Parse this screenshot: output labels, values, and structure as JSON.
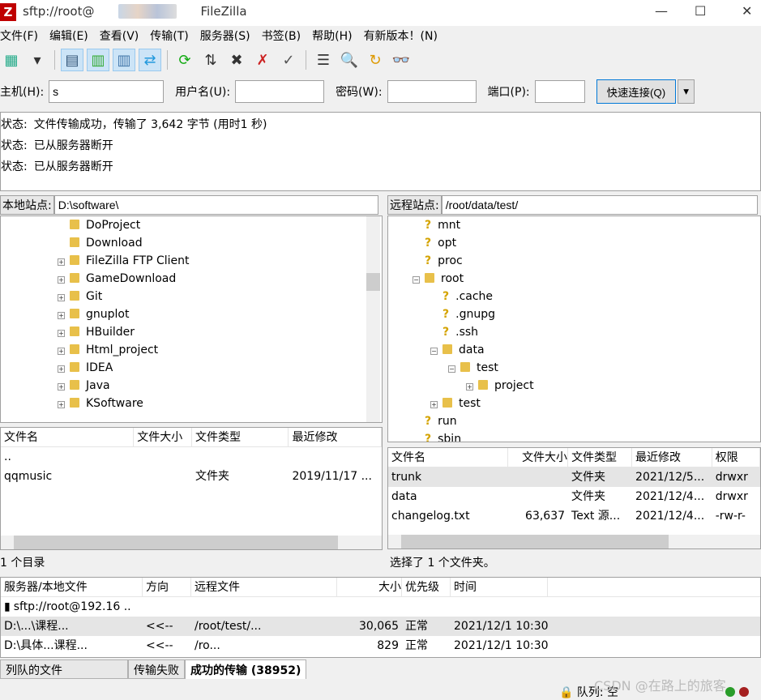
{
  "window": {
    "title": "sftp://root@",
    "title_app": "FileZilla",
    "min": "—",
    "max": "☐",
    "close": "✕"
  },
  "menu": [
    "文件(F)",
    "编辑(E)",
    "查看(V)",
    "传输(T)",
    "服务器(S)",
    "书签(B)",
    "帮助(H)",
    "有新版本！(N)"
  ],
  "toolbar": [
    {
      "name": "site-manager-icon",
      "glyph": "▦"
    },
    {
      "name": "dropdown-arrow-icon",
      "glyph": "▾"
    },
    {
      "name": "toggle-log-icon",
      "glyph": "▤",
      "on": true
    },
    {
      "name": "toggle-local-tree-icon",
      "glyph": "▥",
      "on": true
    },
    {
      "name": "toggle-remote-tree-icon",
      "glyph": "▥",
      "on": true
    },
    {
      "name": "toggle-queue-icon",
      "glyph": "⇄",
      "on": true
    },
    {
      "name": "refresh-icon",
      "glyph": "⟳"
    },
    {
      "name": "process-queue-icon",
      "glyph": "⇅"
    },
    {
      "name": "cancel-icon",
      "glyph": "✖"
    },
    {
      "name": "disconnect-icon",
      "glyph": "✗"
    },
    {
      "name": "reconnect-icon",
      "glyph": "✓"
    },
    {
      "name": "directory-compare-icon",
      "glyph": "☰"
    },
    {
      "name": "search-icon",
      "glyph": "🔍"
    },
    {
      "name": "sync-browse-icon",
      "glyph": "↻"
    },
    {
      "name": "find-files-icon",
      "glyph": "👓"
    }
  ],
  "quickconnect": {
    "host_label": "主机(H):",
    "host_value": "s",
    "user_label": "用户名(U):",
    "user_value": "",
    "pass_label": "密码(W):",
    "pass_value": "",
    "port_label": "端口(P):",
    "port_value": "",
    "connect": "快速连接(Q)"
  },
  "log": [
    {
      "label": "状态:",
      "text": "文件传输成功，传输了 3,642 字节 (用时1 秒)"
    },
    {
      "label": "状态:",
      "text": "已从服务器断开"
    },
    {
      "label": "状态:",
      "text": "已从服务器断开"
    }
  ],
  "local": {
    "site_label": "本地站点:",
    "path": "D:\\software\\",
    "tree": [
      {
        "name": "DoProject",
        "exp": false
      },
      {
        "name": "Download",
        "exp": false
      },
      {
        "name": "FileZilla FTP Client",
        "exp": true
      },
      {
        "name": "GameDownload",
        "exp": true
      },
      {
        "name": "Git",
        "exp": true
      },
      {
        "name": "gnuplot",
        "exp": true
      },
      {
        "name": "HBuilder",
        "exp": true
      },
      {
        "name": "Html_project",
        "exp": true
      },
      {
        "name": "IDEA",
        "exp": true
      },
      {
        "name": "Java",
        "exp": true
      },
      {
        "name": "KSoftware",
        "exp": true
      }
    ],
    "columns": [
      "文件名",
      "文件大小",
      "文件类型",
      "最近修改"
    ],
    "files": [
      {
        "name": "..",
        "size": "",
        "type": "",
        "modified": ""
      },
      {
        "name": "qqmusic",
        "size": "",
        "type": "文件夹",
        "modified": "2019/11/17 ..."
      }
    ],
    "status": "1 个目录"
  },
  "remote": {
    "site_label": "远程站点:",
    "path": "/root/data/test/",
    "tree": [
      {
        "name": "mnt",
        "icon": "q",
        "lvl": 0
      },
      {
        "name": "opt",
        "icon": "q",
        "lvl": 0
      },
      {
        "name": "proc",
        "icon": "q",
        "lvl": 0
      },
      {
        "name": "root",
        "icon": "f",
        "lvl": 0,
        "exp": "−"
      },
      {
        "name": ".cache",
        "icon": "q",
        "lvl": 1
      },
      {
        "name": ".gnupg",
        "icon": "q",
        "lvl": 1
      },
      {
        "name": ".ssh",
        "icon": "q",
        "lvl": 1
      },
      {
        "name": "data",
        "icon": "f",
        "lvl": 1,
        "exp": "−"
      },
      {
        "name": "test",
        "icon": "f",
        "lvl": 2,
        "exp": "−"
      },
      {
        "name": "project",
        "icon": "f",
        "lvl": 3,
        "exp": "+"
      },
      {
        "name": "test",
        "icon": "f",
        "lvl": 1,
        "exp": "+"
      },
      {
        "name": "run",
        "icon": "q",
        "lvl": 0
      },
      {
        "name": "sbin",
        "icon": "q",
        "lvl": 0
      }
    ],
    "columns": [
      "文件名",
      "文件大小",
      "文件类型",
      "最近修改",
      "权限"
    ],
    "files": [
      {
        "name": "trunk",
        "size": "",
        "type": "文件夹",
        "modified": "2021/12/5...",
        "perm": "drwxr"
      },
      {
        "name": "data",
        "size": "",
        "type": "文件夹",
        "modified": "2021/12/4...",
        "perm": "drwxr"
      },
      {
        "name": "changelog.txt",
        "size": "63,637",
        "type": "Text 源...",
        "modified": "2021/12/4...",
        "perm": "-rw-r-"
      }
    ],
    "status": "选择了 1 个文件夹。"
  },
  "queue": {
    "columns": [
      "服务器/本地文件",
      "方向",
      "远程文件",
      "大小",
      "优先级",
      "时间"
    ],
    "server": "sftp://root@192.16 ..",
    "rows": [
      {
        "local": "D:\\...\\课程...",
        "dir": "<<--",
        "remote": "/root/test/...",
        "size": "30,065",
        "priority": "正常",
        "time": "2021/12/1 10:30:..."
      },
      {
        "local": "D:\\具体...课程...",
        "dir": "<<--",
        "remote": "/ro...",
        "size": "829",
        "priority": "正常",
        "time": "2021/12/1 10:30:..."
      }
    ]
  },
  "tabs": [
    "列队的文件",
    "传输失败",
    "成功的传输 (38952)"
  ],
  "statusbar": {
    "queue": "队列: 空",
    "watermark": "CSDN @在路上的旅客"
  }
}
